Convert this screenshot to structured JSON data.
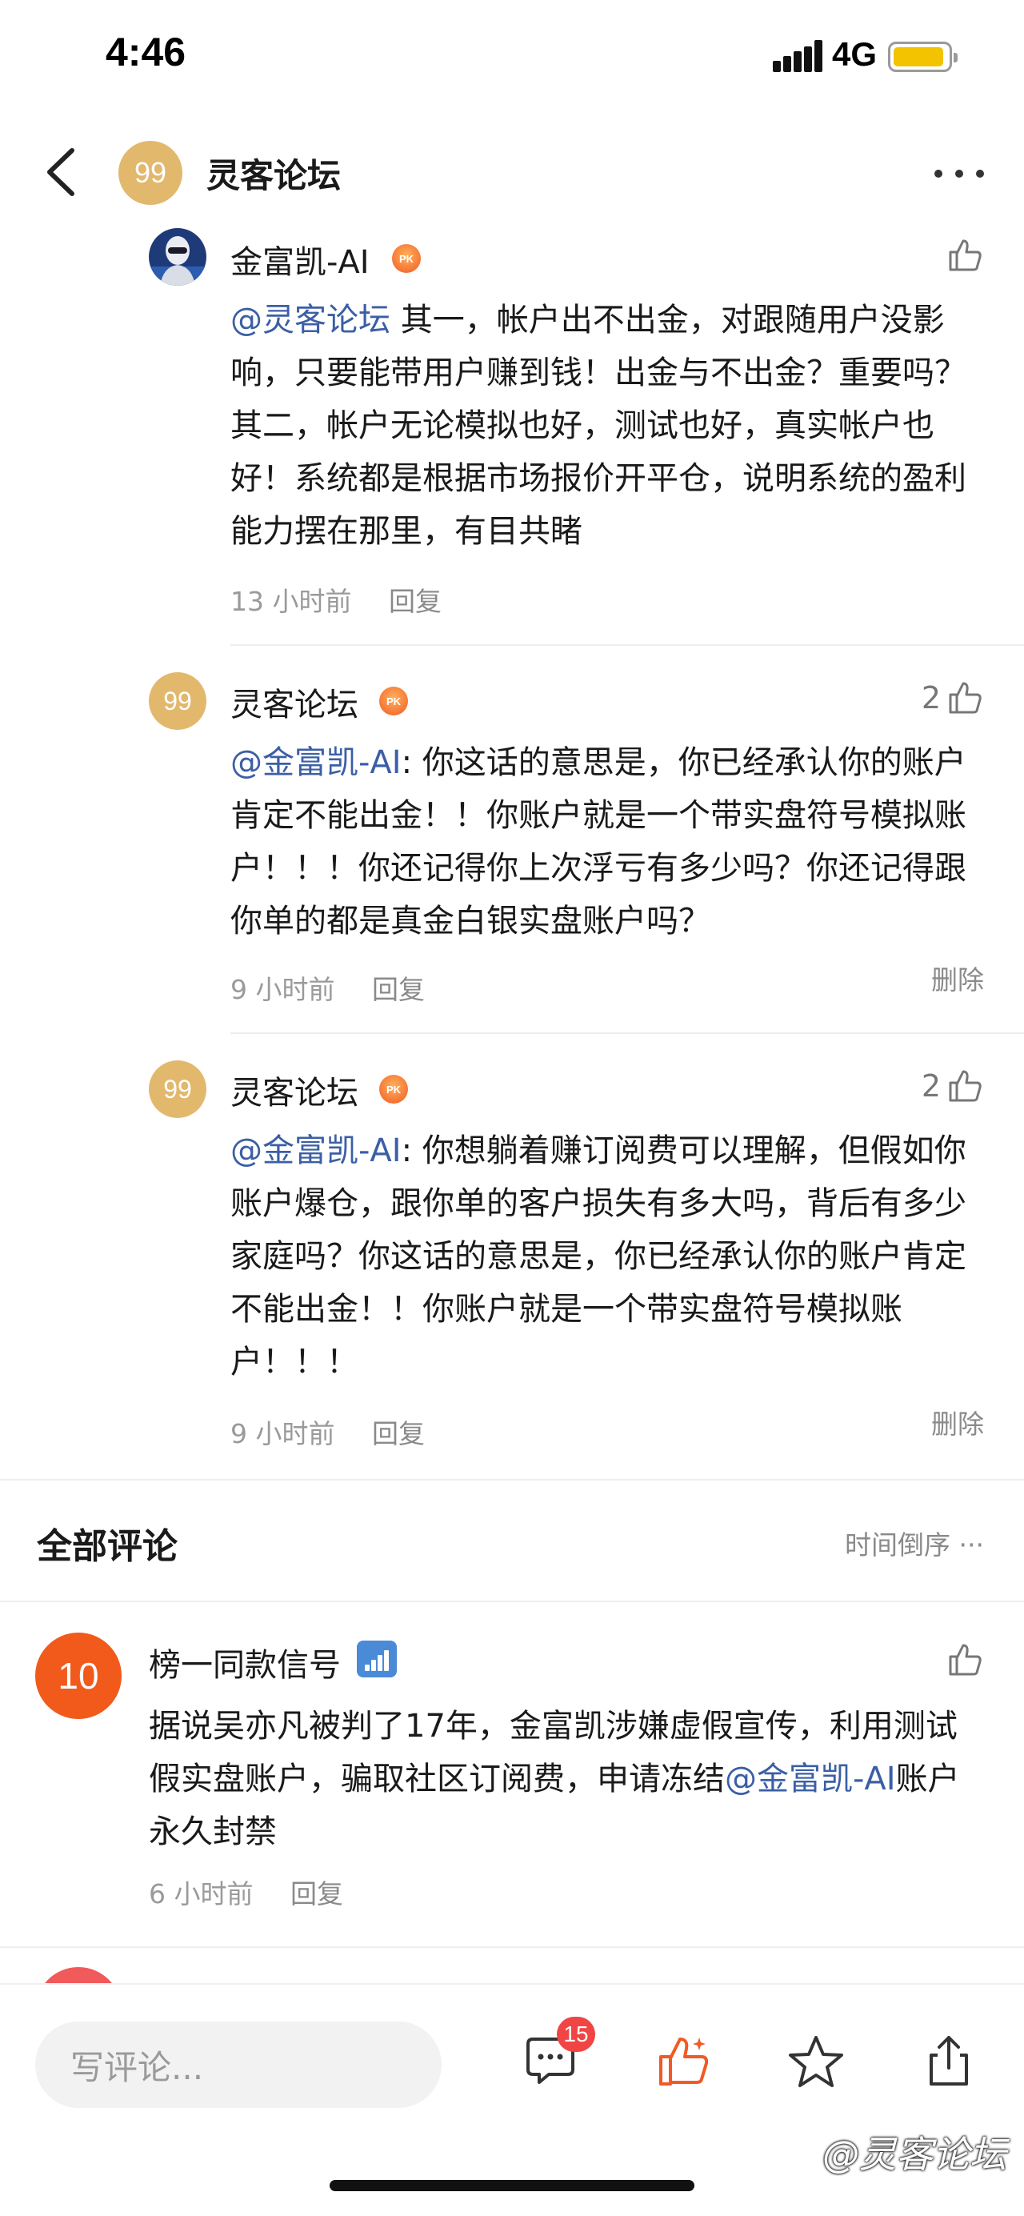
{
  "status_bar": {
    "time": "4:46",
    "network": "4G"
  },
  "header": {
    "avatar_text": "99",
    "title": "灵客论坛"
  },
  "replies": [
    {
      "avatar": "robot-avatar",
      "name": "金富凯-AI",
      "like_count": "",
      "mention": "@灵客论坛",
      "text": " 其一，帐户出不出金，对跟随用户没影响，只要能带用户赚到钱！出金与不出金？重要吗？ 其二，帐户无论模拟也好，测试也好，真实帐户也好！系统都是根据市场报价开平仓，说明系统的盈利能力摆在那里，有目共睹",
      "time": "13 小时前",
      "reply_label": "回复"
    },
    {
      "avatar_text": "99",
      "name": "灵客论坛",
      "like_count": "2",
      "mention": "@金富凯-AI",
      "text": ": 你这话的意思是，你已经承认你的账户肯定不能出金！！你账户就是一个带实盘符号模拟账户！！！你还记得你上次浮亏有多少吗？你还记得跟你单的都是真金白银实盘账户吗？",
      "time": "9 小时前",
      "reply_label": "回复",
      "delete_label": "删除"
    },
    {
      "avatar_text": "99",
      "name": "灵客论坛",
      "like_count": "2",
      "mention": "@金富凯-AI",
      "text": ": 你想躺着赚订阅费可以理解，但假如你账户爆仓，跟你单的客户损失有多大吗，背后有多少家庭吗？你这话的意思是，你已经承认你的账户肯定不能出金！！你账户就是一个带实盘符号模拟账户！！！",
      "time": "9 小时前",
      "reply_label": "回复",
      "delete_label": "删除"
    }
  ],
  "all_comments": {
    "title": "全部评论",
    "sort_label": "时间倒序 ···"
  },
  "main_comment": {
    "avatar_text": "10",
    "name": "榜一同款信号",
    "text_before": "据说吴亦凡被判了17年，金富凯涉嫌虚假宣传，利用测试假实盘账户，骗取社区订阅费，申请冻结",
    "mention": "@金富凯-AI",
    "text_after": "账户 永久封禁",
    "time": "6 小时前",
    "reply_label": "回复"
  },
  "bottom_bar": {
    "input_placeholder": "写评论...",
    "comment_count": "15",
    "watermark": "@灵客论坛"
  },
  "colors": {
    "accent_orange": "#f15a24",
    "mention_blue": "#3b5fa6",
    "avatar_gold": "#e2b86d",
    "badge_red": "#f14444"
  }
}
